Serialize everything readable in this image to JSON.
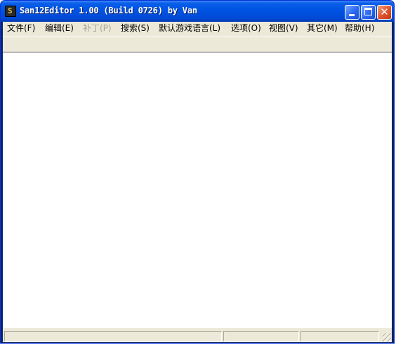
{
  "window": {
    "title": "San12Editor 1.00 (Build 0726) by Van"
  },
  "menu": [
    {
      "label": "文件(F)",
      "enabled": true
    },
    {
      "label": "编辑(E)",
      "enabled": true
    },
    {
      "label": "补丁(P)",
      "enabled": false
    },
    {
      "label": "搜索(S)",
      "enabled": true
    },
    {
      "label": "默认游戏语言(L)",
      "enabled": true
    },
    {
      "label": "选项(O)",
      "enabled": true
    },
    {
      "label": "视图(V)",
      "enabled": true
    },
    {
      "label": "其它(M)",
      "enabled": true
    },
    {
      "label": "帮助(H)",
      "enabled": true
    }
  ],
  "colors": {
    "titlebar": "#0055e5",
    "chrome": "#ece9d8",
    "close_button": "#e0502a",
    "disabled_text": "#a6a39a"
  },
  "icons": [
    "app-icon",
    "minimize-icon",
    "maximize-icon",
    "close-icon",
    "size-grip-icon"
  ]
}
